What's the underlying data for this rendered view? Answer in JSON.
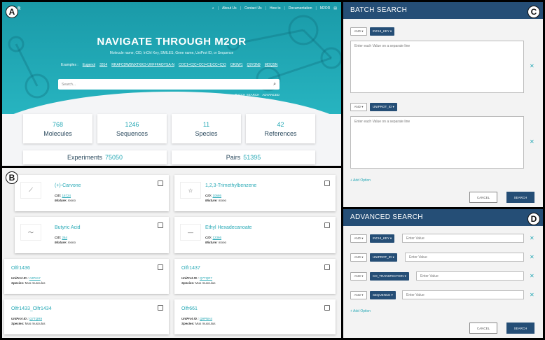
{
  "labels": {
    "a": "A",
    "b": "B",
    "c": "C",
    "d": "D"
  },
  "nav": {
    "logo": "R",
    "search_icon": "search-icon",
    "items": [
      "About Us",
      "Contact Us",
      "How to",
      "Documentation"
    ],
    "brand": "M2OR"
  },
  "hero": {
    "title": "NAVIGATE THROUGH M2OR",
    "subtitle": "Molecule name, CID, InChI Key, SMILES, Gene name, UniProt ID, or Sequence",
    "examples_label": "Examples :",
    "examples": [
      "Eugenol",
      "3314",
      "RRAFCDWBNXTKKO-UHFFFAOYSA-N",
      "COC1=C(C=CC(=C1)CC=C)O",
      "OR2W1",
      "Q9Y3N9",
      "MDQSN"
    ],
    "search_placeholder": "Search...",
    "batch_link": "BATCH SEARCH",
    "advanced_link": "ADVANCED"
  },
  "stats": [
    {
      "value": "768",
      "label": "Molecules"
    },
    {
      "value": "1246",
      "label": "Sequences"
    },
    {
      "value": "11",
      "label": "Species"
    },
    {
      "value": "42",
      "label": "References"
    }
  ],
  "wide_stats": [
    {
      "label": "Experiments",
      "value": "75050"
    },
    {
      "label": "Pairs",
      "value": "51395"
    }
  ],
  "molecule_cards": [
    {
      "title": "(+)-Carvone",
      "cid_label": "CID:",
      "cid": "16724",
      "mix_label": "Mixture:",
      "mix": "mono"
    },
    {
      "title": "1,2,3-Trimethylbenzene",
      "cid_label": "CID:",
      "cid": "10686",
      "mix_label": "Mixture:",
      "mix": "mono"
    },
    {
      "title": "Butyric Acid",
      "cid_label": "CID:",
      "cid": "264",
      "mix_label": "Mixture:",
      "mix": "mono"
    },
    {
      "title": "Ethyl Hexadecanoate",
      "cid_label": "CID:",
      "cid": "12366",
      "mix_label": "Mixture:",
      "mix": "mono"
    }
  ],
  "receptor_cards": [
    {
      "title": "Olfr1436",
      "uni_label": "UniProt ID :",
      "uni": "A0P617",
      "sp_label": "Species:",
      "sp": "Mus musculus"
    },
    {
      "title": "Olfr1437",
      "uni_label": "UniProt ID :",
      "uni": "Q7TQR7",
      "sp_label": "Species:",
      "sp": "Mus musculus"
    },
    {
      "title": "Olfr1433_Olfr1434",
      "uni_label": "UniProt ID :",
      "uni": "Q7TQR9",
      "sp_label": "Species:",
      "sp": "Mus musculus"
    },
    {
      "title": "Olfr661",
      "uni_label": "UniProt ID :",
      "uni": "Q9PNH4",
      "sp_label": "Species:",
      "sp": "Mus musculus"
    }
  ],
  "batch": {
    "title": "BATCH SEARCH",
    "rows": [
      {
        "op": "AND ▾",
        "field": "INCHI_KEY ▾",
        "placeholder": "Enter each Value on a separate line"
      },
      {
        "op": "AND ▾",
        "field": "UNIPROT_ID ▾",
        "placeholder": "Enter each Value on a separate line"
      }
    ],
    "add_option": "+ Add Option",
    "cancel": "CANCEL",
    "search": "SEARCH",
    "remove_glyph": "✕"
  },
  "advanced": {
    "title": "ADVANCED SEARCH",
    "rows": [
      {
        "op": "AND ▾",
        "field": "INCHI_KEY ▾",
        "placeholder": "Enter Value"
      },
      {
        "op": "AND ▾",
        "field": "UNIPROT_ID ▾",
        "placeholder": "Enter Value"
      },
      {
        "op": "AND ▾",
        "field": "CO_TRANSFECTION ▾",
        "placeholder": "Enter Value"
      },
      {
        "op": "AND ▾",
        "field": "SEQUENCE ▾",
        "placeholder": "Enter Value"
      }
    ],
    "add_option": "+ Add Option",
    "cancel": "CANCEL",
    "search": "SEARCH",
    "remove_glyph": "✕"
  },
  "colors": {
    "teal": "#27a9b6",
    "navy": "#254e76"
  }
}
